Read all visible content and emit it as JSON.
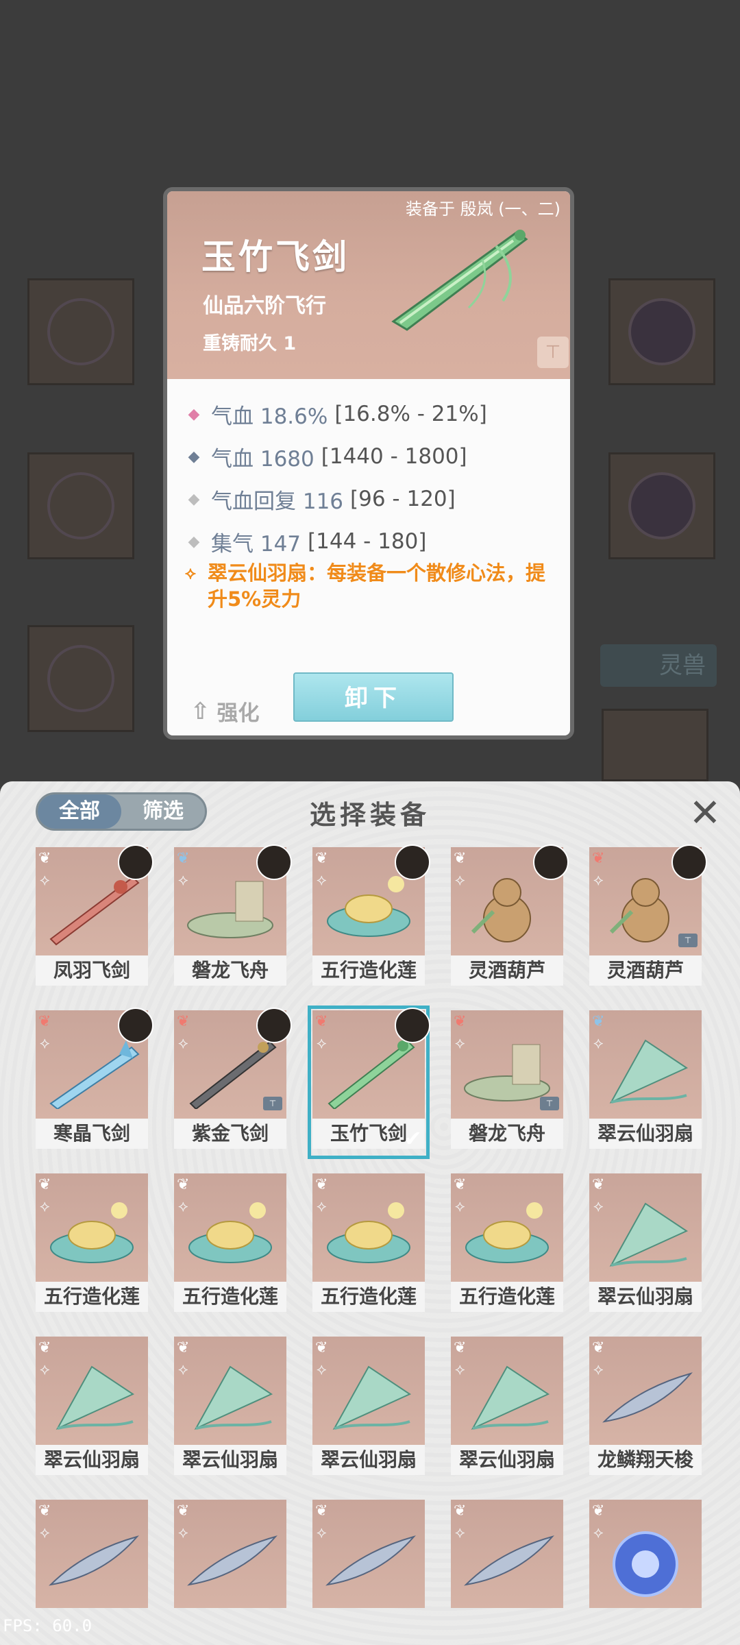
{
  "card": {
    "equipped_by": "装备于 殷岚 (一、二)",
    "title": "玉竹飞剑",
    "subtitle": "仙品六阶飞行",
    "durability": "重铸耐久 1",
    "stats": [
      {
        "label": "气血 18.6%",
        "range": "[16.8% - 21%]",
        "color": "#e07fa8"
      },
      {
        "label": "气血 1680",
        "range": "[1440 - 1800]",
        "color": "#6f7f95"
      },
      {
        "label": "气血回复 116",
        "range": "[96 - 120]",
        "color": "#bdbdbd"
      },
      {
        "label": "集气 147",
        "range": "[144 - 180]",
        "color": "#bdbdbd"
      }
    ],
    "skill": "翠云仙羽扇：每装备一个散修心法，提升5%灵力",
    "enhance_label": "强化",
    "unequip_label": "卸下"
  },
  "background": {
    "lingshou_label": "灵兽"
  },
  "panel": {
    "title": "选择装备",
    "tabs": [
      "全部",
      "筛选"
    ],
    "close_icon": "close-icon",
    "items": [
      {
        "name": "凤羽飞剑",
        "wing": "white",
        "avatar": true,
        "art": "sword-red",
        "lock": false,
        "selected": false
      },
      {
        "name": "磐龙飞舟",
        "wing": "blue",
        "avatar": true,
        "art": "boat",
        "lock": false,
        "selected": false
      },
      {
        "name": "五行造化莲",
        "wing": "white",
        "avatar": true,
        "art": "lotus",
        "lock": false,
        "selected": false
      },
      {
        "name": "灵酒葫芦",
        "wing": "white",
        "avatar": true,
        "art": "gourd",
        "lock": false,
        "selected": false
      },
      {
        "name": "灵酒葫芦",
        "wing": "red",
        "avatar": true,
        "art": "gourd",
        "lock": true,
        "selected": false
      },
      {
        "name": "寒晶飞剑",
        "wing": "red",
        "avatar": true,
        "art": "sword-blue",
        "lock": false,
        "selected": false
      },
      {
        "name": "紫金飞剑",
        "wing": "red",
        "avatar": true,
        "art": "sword-dark",
        "lock": true,
        "selected": false
      },
      {
        "name": "玉竹飞剑",
        "wing": "red",
        "avatar": true,
        "art": "sword-green",
        "lock": false,
        "selected": true
      },
      {
        "name": "磐龙飞舟",
        "wing": "red",
        "avatar": false,
        "art": "boat",
        "lock": true,
        "selected": false
      },
      {
        "name": "翠云仙羽扇",
        "wing": "blue",
        "avatar": false,
        "art": "fan",
        "lock": false,
        "selected": false
      },
      {
        "name": "五行造化莲",
        "wing": "white",
        "avatar": false,
        "art": "lotus",
        "lock": false,
        "selected": false
      },
      {
        "name": "五行造化莲",
        "wing": "white",
        "avatar": false,
        "art": "lotus",
        "lock": false,
        "selected": false
      },
      {
        "name": "五行造化莲",
        "wing": "white",
        "avatar": false,
        "art": "lotus",
        "lock": false,
        "selected": false
      },
      {
        "name": "五行造化莲",
        "wing": "white",
        "avatar": false,
        "art": "lotus",
        "lock": false,
        "selected": false
      },
      {
        "name": "翠云仙羽扇",
        "wing": "white",
        "avatar": false,
        "art": "fan",
        "lock": false,
        "selected": false
      },
      {
        "name": "翠云仙羽扇",
        "wing": "white",
        "avatar": false,
        "art": "fan",
        "lock": false,
        "selected": false
      },
      {
        "name": "翠云仙羽扇",
        "wing": "white",
        "avatar": false,
        "art": "fan",
        "lock": false,
        "selected": false
      },
      {
        "name": "翠云仙羽扇",
        "wing": "white",
        "avatar": false,
        "art": "fan",
        "lock": false,
        "selected": false
      },
      {
        "name": "翠云仙羽扇",
        "wing": "white",
        "avatar": false,
        "art": "fan",
        "lock": false,
        "selected": false
      },
      {
        "name": "龙鳞翔天梭",
        "wing": "white",
        "avatar": false,
        "art": "shuttle",
        "lock": false,
        "selected": false
      },
      {
        "name": "",
        "wing": "white",
        "avatar": false,
        "art": "shuttle",
        "lock": false,
        "selected": false
      },
      {
        "name": "",
        "wing": "white",
        "avatar": false,
        "art": "shuttle",
        "lock": false,
        "selected": false
      },
      {
        "name": "",
        "wing": "white",
        "avatar": false,
        "art": "shuttle",
        "lock": false,
        "selected": false
      },
      {
        "name": "",
        "wing": "white",
        "avatar": false,
        "art": "shuttle",
        "lock": false,
        "selected": false
      },
      {
        "name": "",
        "wing": "white",
        "avatar": false,
        "art": "orb",
        "lock": false,
        "selected": false
      }
    ]
  },
  "fps": "FPS: 60.0"
}
